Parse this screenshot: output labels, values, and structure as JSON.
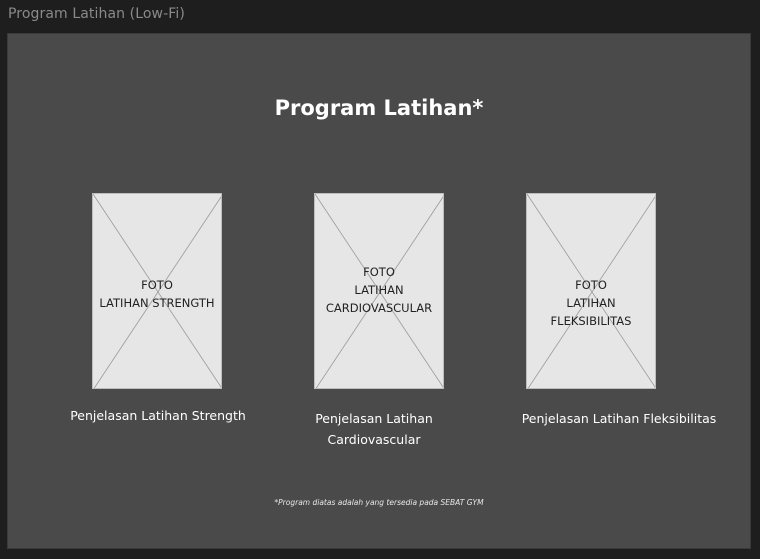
{
  "window": {
    "frame_title": "Program Latihan (Low-Fi)"
  },
  "page": {
    "title": "Program Latihan*",
    "footnote": "*Program diatas adalah yang tersedia pada SEBAT GYM"
  },
  "programs": [
    {
      "image_text": "FOTO\nLATIHAN STRENGTH",
      "caption": "Penjelasan Latihan Strength"
    },
    {
      "image_text": "FOTO\nLATIHAN\nCARDIOVASCULAR",
      "caption": "Penjelasan Latihan\nCardiovascular"
    },
    {
      "image_text": "FOTO\nLATIHAN FLEKSIBILITAS",
      "caption": "Penjelasan Latihan Fleksibilitas"
    }
  ],
  "colors": {
    "background": "#1e1e1e",
    "frame": "#4a4a4a",
    "placeholder": "#e6e6e6",
    "text": "#ffffff"
  }
}
